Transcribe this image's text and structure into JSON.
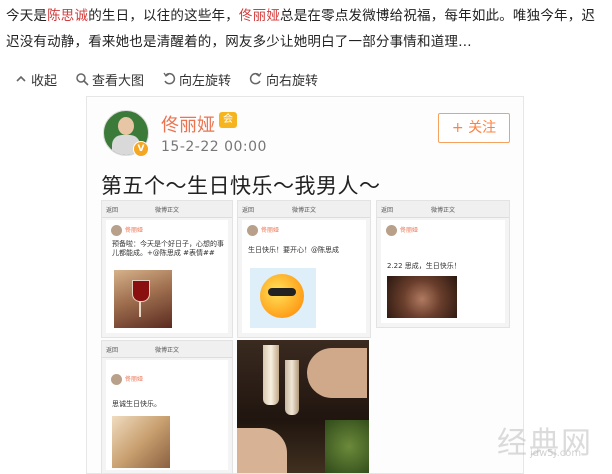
{
  "article": {
    "p1": "今天是",
    "name1": "陈思诚",
    "p2": "的生日，以往的这些年，",
    "name2": "佟丽娅",
    "p3": "总是在零点发微博给祝福，每年如此。唯独今年，迟迟没有动静，看来她也是清醒着的，网友多少让她明白了一部分事情和道理…"
  },
  "toolbar": {
    "collapse": "收起",
    "view_large": "查看大图",
    "rotate_left": "向左旋转",
    "rotate_right": "向右旋转"
  },
  "weibo": {
    "username": "佟丽娅",
    "badge": "V",
    "crown": "会",
    "time": "15-2-22 00:00",
    "follow": "+ 关注",
    "post_text": "第五个～生日快乐～我男人～",
    "shots": [
      {
        "back": "返回",
        "title": "微博正文",
        "name": "佟丽娅",
        "text": "预备啦：今天是个好日子，心想的事儿都能成。+@陈思成 #表情##"
      },
      {
        "back": "返回",
        "title": "微博正文",
        "name": "佟丽娅",
        "text": "生日快乐！要开心！@陈思成"
      },
      {
        "back": "返回",
        "title": "微博正文",
        "name": "佟丽娅",
        "text": "2.22 思成，生日快乐！"
      },
      {
        "back": "返回",
        "title": "微博正文",
        "name": "佟丽娅",
        "text": "思诚生日快乐。"
      }
    ]
  },
  "watermark": {
    "text": "经典网",
    "url": "jdw5J.com"
  }
}
